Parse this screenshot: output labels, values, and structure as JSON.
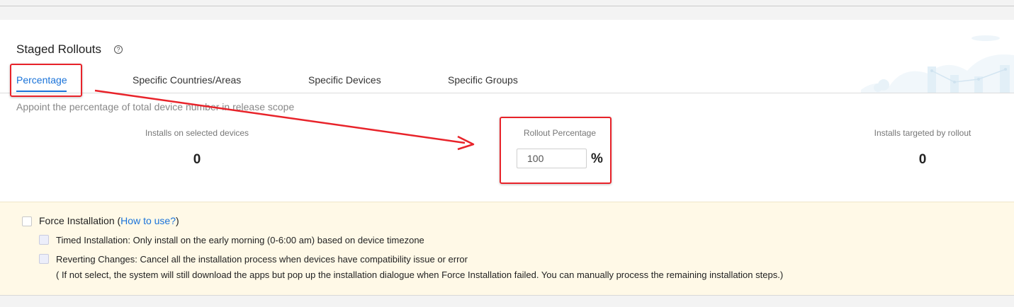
{
  "section": {
    "title": "Staged Rollouts",
    "help_icon": "question-circle-icon"
  },
  "tabs": [
    {
      "label": "Percentage",
      "active": true
    },
    {
      "label": "Specific Countries/Areas",
      "active": false
    },
    {
      "label": "Specific Devices",
      "active": false
    },
    {
      "label": "Specific Groups",
      "active": false
    }
  ],
  "description": "Appoint the percentage of total device number in release scope",
  "stats": {
    "installs_selected": {
      "label": "Installs on selected devices",
      "value": "0"
    },
    "rollout_percentage": {
      "label": "Rollout Percentage",
      "value": "100",
      "unit": "%"
    },
    "installs_targeted": {
      "label": "Installs targeted by rollout",
      "value": "0"
    }
  },
  "force_installation": {
    "label": "Force Installation (",
    "link": "How to use?",
    "label_end": ")",
    "checked": false,
    "options": [
      {
        "label": "Timed Installation: Only install on the early morning (0-6:00 am) based on device timezone",
        "checked": false
      },
      {
        "label": "Reverting Changes: Cancel all the installation process when devices have compatibility issue or error",
        "checked": false
      }
    ],
    "note": "( If not select, the system will still download the apps but pop up the installation dialogue when Force Installation failed. You can manually process the remaining installation steps.)"
  },
  "colors": {
    "accent": "#1a73d9",
    "highlight": "#e8232a",
    "force_bg": "#fff9e7"
  }
}
